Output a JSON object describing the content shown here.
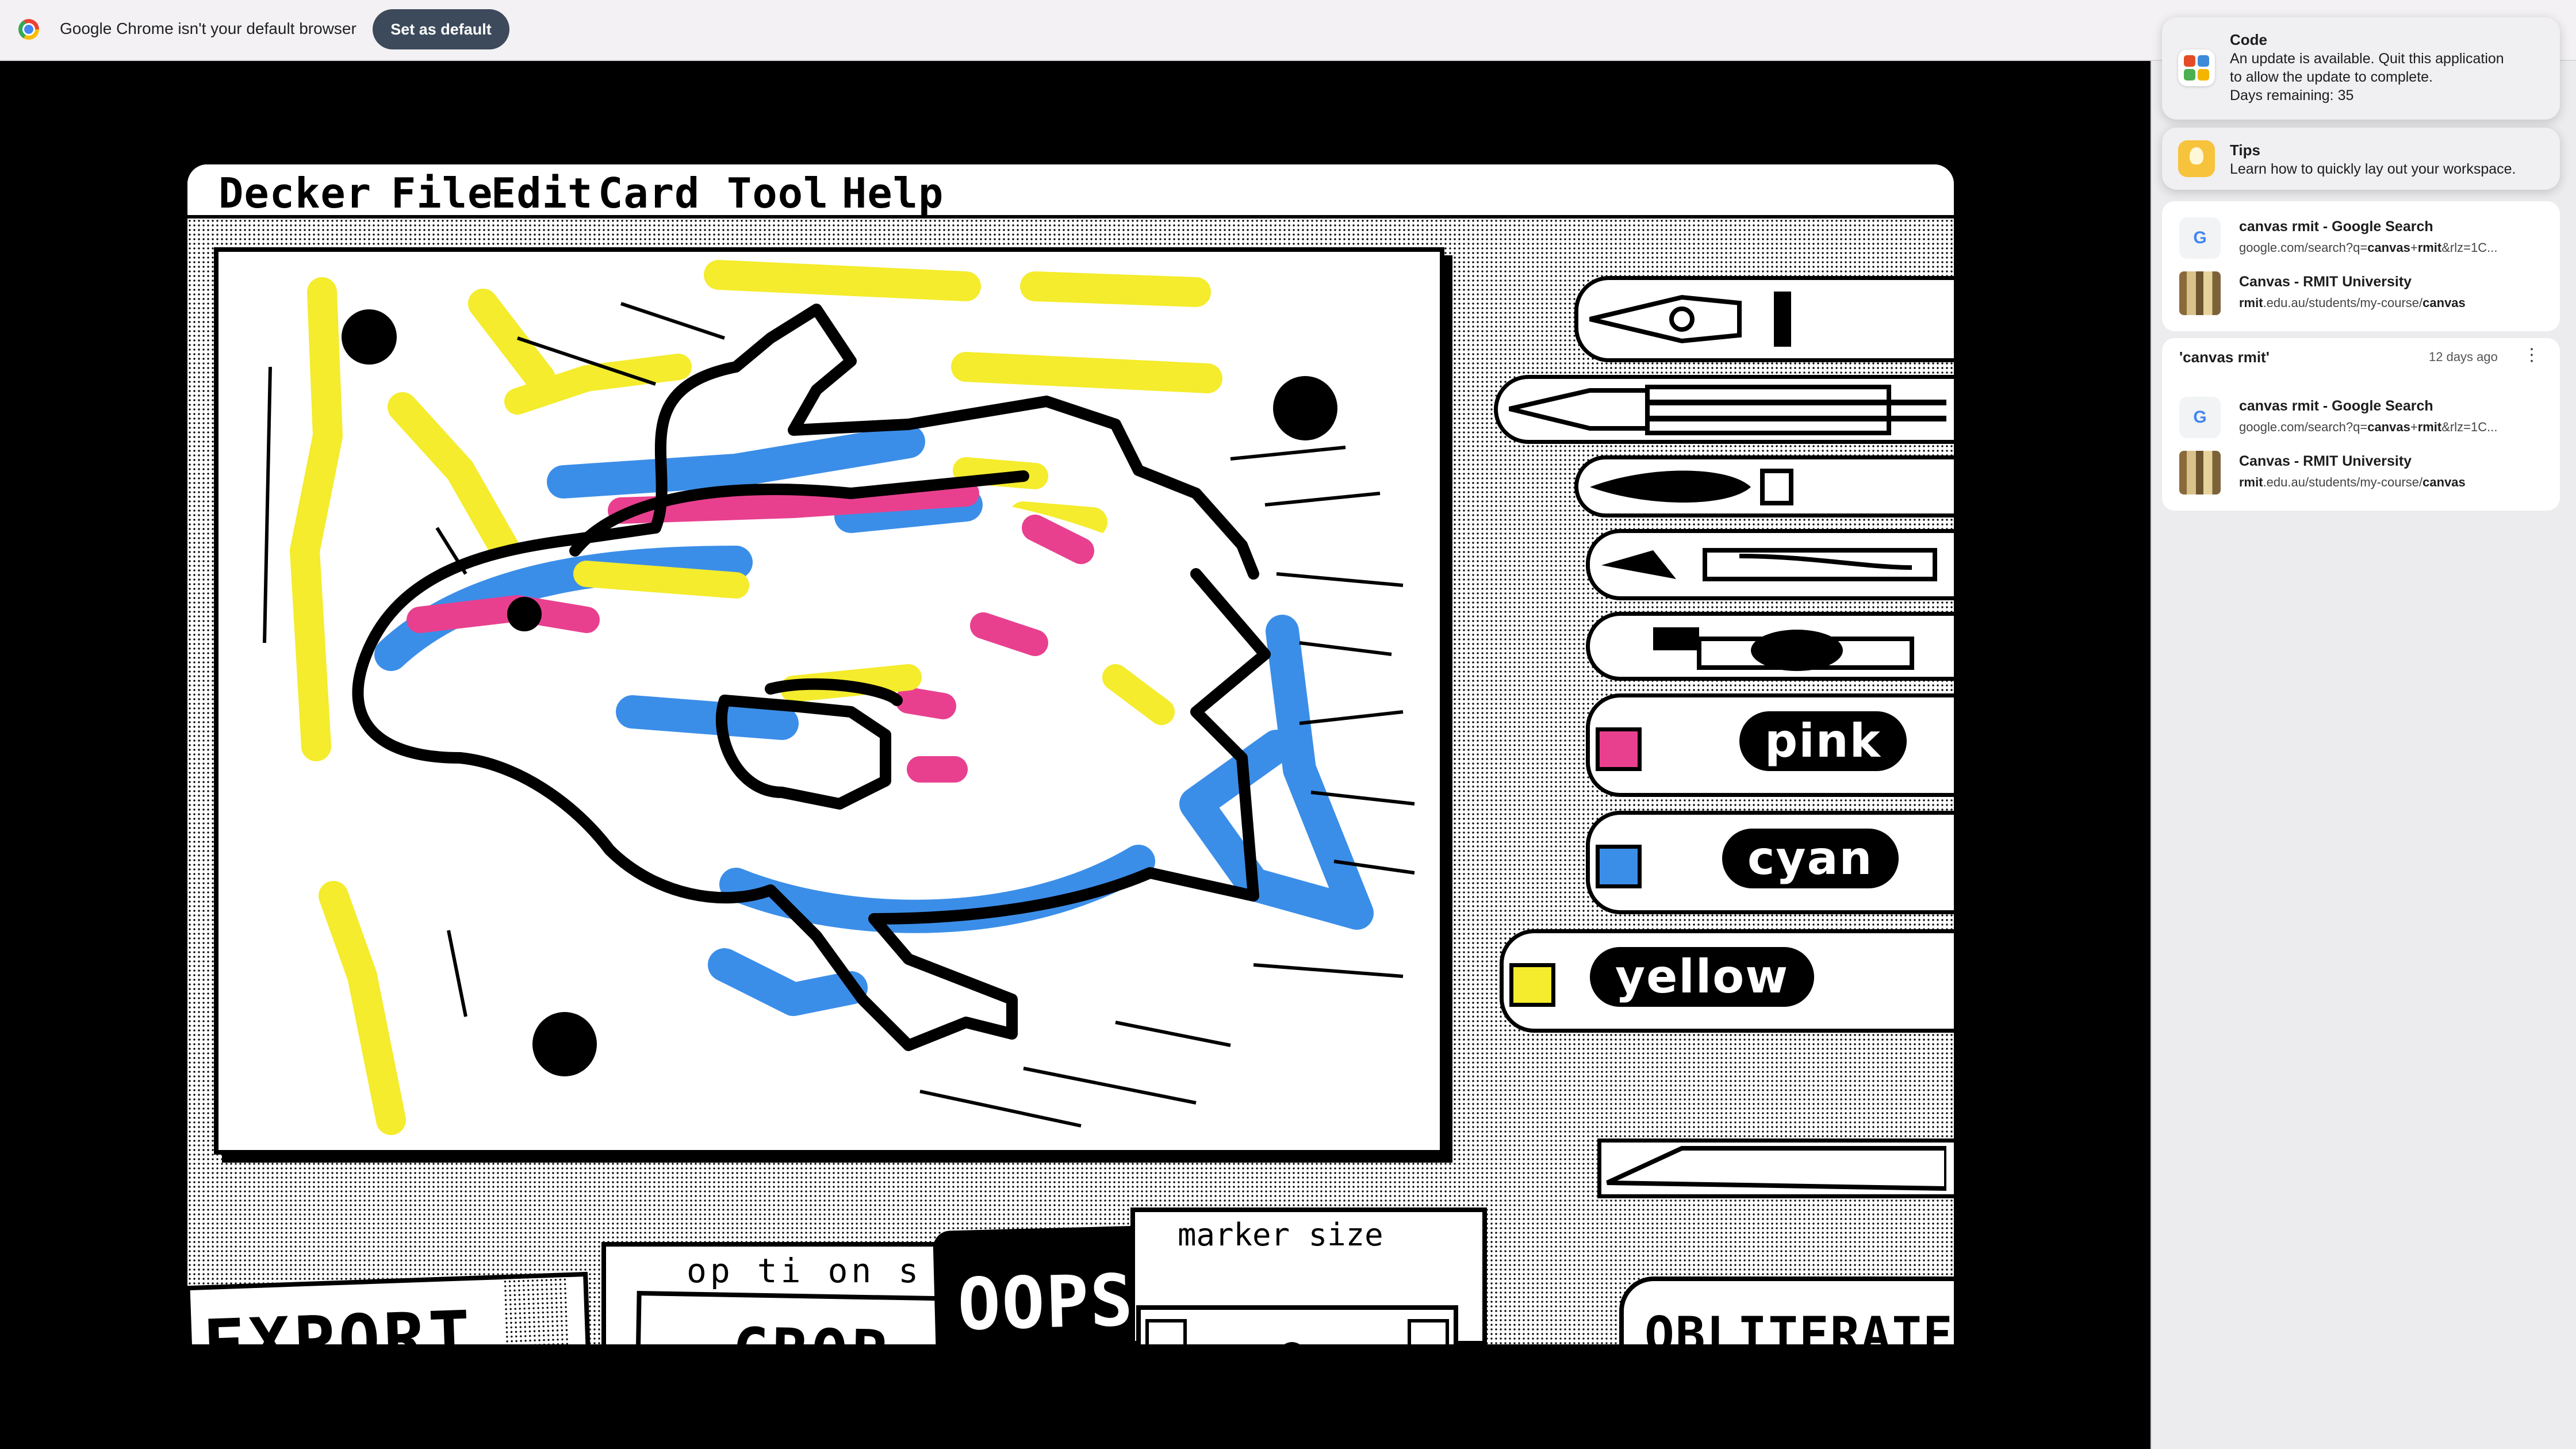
{
  "browser": {
    "infobar_message": "Google Chrome isn't your default browser",
    "set_default_label": "Set as default"
  },
  "decker": {
    "menu": [
      "Decker",
      "File",
      "Edit",
      "Card",
      "Tool",
      "Help"
    ],
    "markers": [
      {
        "label": "pink",
        "color": "#e8408f"
      },
      {
        "label": "cyan",
        "color": "#3b8ee8"
      },
      {
        "label": "yellow",
        "color": "#f4ec2c"
      }
    ],
    "buttons": {
      "export": "EXPORT",
      "options": "op ti on s",
      "crop": "CROP",
      "oops": "OOPS!",
      "marker_size": "marker size",
      "obliterate": "OBLITERATE!"
    }
  },
  "notifications": [
    {
      "title": "Code",
      "body": [
        "An update is available. Quit this application",
        "to allow the update to complete.",
        "Days remaining: 35"
      ]
    },
    {
      "title": "Tips",
      "body": [
        "Learn how to quickly lay out your workspace."
      ]
    }
  ],
  "history": {
    "recent": [
      {
        "title": "canvas rmit - Google Search",
        "url_parts": [
          "google.com/search?q=",
          "canvas",
          "+",
          "rmit",
          "&rlz=1C..."
        ],
        "icon": "google-icon"
      },
      {
        "title": "Canvas - RMIT University",
        "url_parts": [
          "rmit",
          ".edu.au/students/my-course/",
          "canvas"
        ],
        "icon": "rmit-icon"
      }
    ],
    "group": {
      "title": "'canvas rmit'",
      "age": "12 days ago",
      "entries": [
        {
          "title": "canvas rmit - Google Search",
          "url_parts": [
            "google.com/search?q=",
            "canvas",
            "+",
            "rmit",
            "&rlz=1C..."
          ],
          "icon": "google-icon"
        },
        {
          "title": "Canvas - RMIT University",
          "url_parts": [
            "rmit",
            ".edu.au/students/my-course/",
            "canvas"
          ],
          "icon": "rmit-icon"
        }
      ]
    }
  },
  "colors": {
    "pink": "#e8408f",
    "cyan": "#3b8ee8",
    "yellow": "#f4ec2c",
    "infobar_button": "#3d4a5c"
  }
}
